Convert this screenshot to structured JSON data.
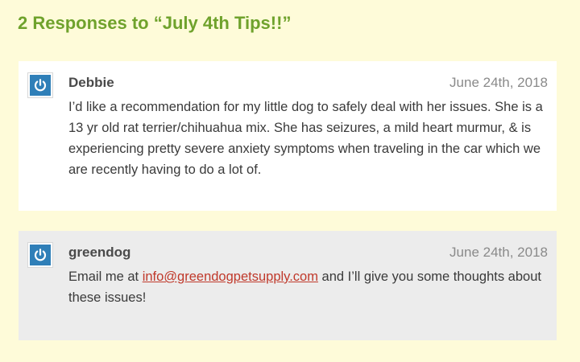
{
  "heading": "2 Responses to “July 4th Tips!!”",
  "comments": [
    {
      "author": "Debbie",
      "date": "June 24th, 2018",
      "text": "I’d like a recommendation for my little dog to safely deal with her issues. She is a 13 yr old rat terrier/chihuahua mix. She has seizures, a mild heart murmur, & is experiencing pretty severe anxiety symptoms when traveling in the car which we are recently having to do a lot of.",
      "avatar_icon": "power-icon"
    },
    {
      "author": "greendog",
      "date": "June 24th, 2018",
      "text_before": "Email me at ",
      "link": "info@greendogpetsupply.com",
      "text_after": " and I’ll give you some thoughts about these issues!",
      "avatar_icon": "power-icon"
    }
  ],
  "colors": {
    "page_background": "#fefbd9",
    "heading": "#6fa22c",
    "link": "#c0392b",
    "avatar": "#2f7fb8"
  }
}
